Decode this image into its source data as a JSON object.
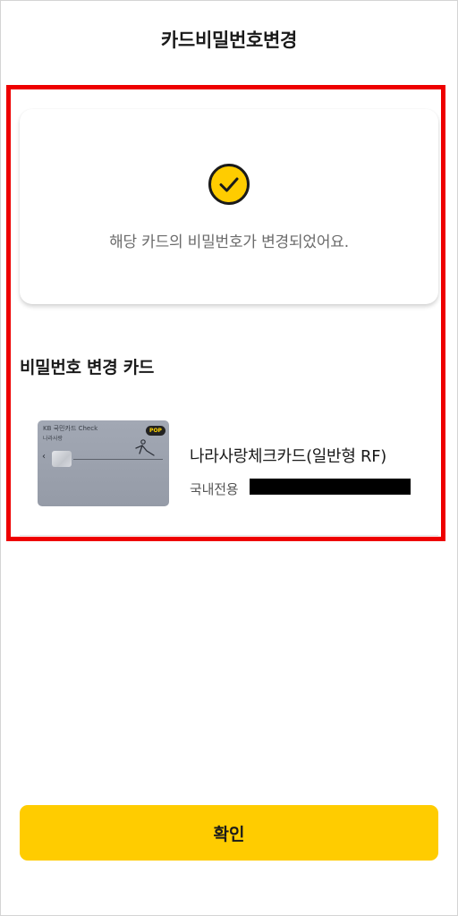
{
  "header": {
    "title": "카드비밀번호변경"
  },
  "success": {
    "icon": "check-circle-icon",
    "message": "해당 카드의 비밀번호가 변경되었어요."
  },
  "section": {
    "title": "비밀번호 변경 카드"
  },
  "card": {
    "image": {
      "brand": "KB 국민카드 Check",
      "subbrand": "나라사랑",
      "badge": "POP"
    },
    "name": "나라사랑체크카드(일반형 RF)",
    "type": "국내전용",
    "number_redacted": true
  },
  "footer": {
    "confirm_label": "확인"
  },
  "colors": {
    "accent": "#ffcc00",
    "highlight": "#ee0000",
    "card_gray": "#9ea4b0"
  }
}
